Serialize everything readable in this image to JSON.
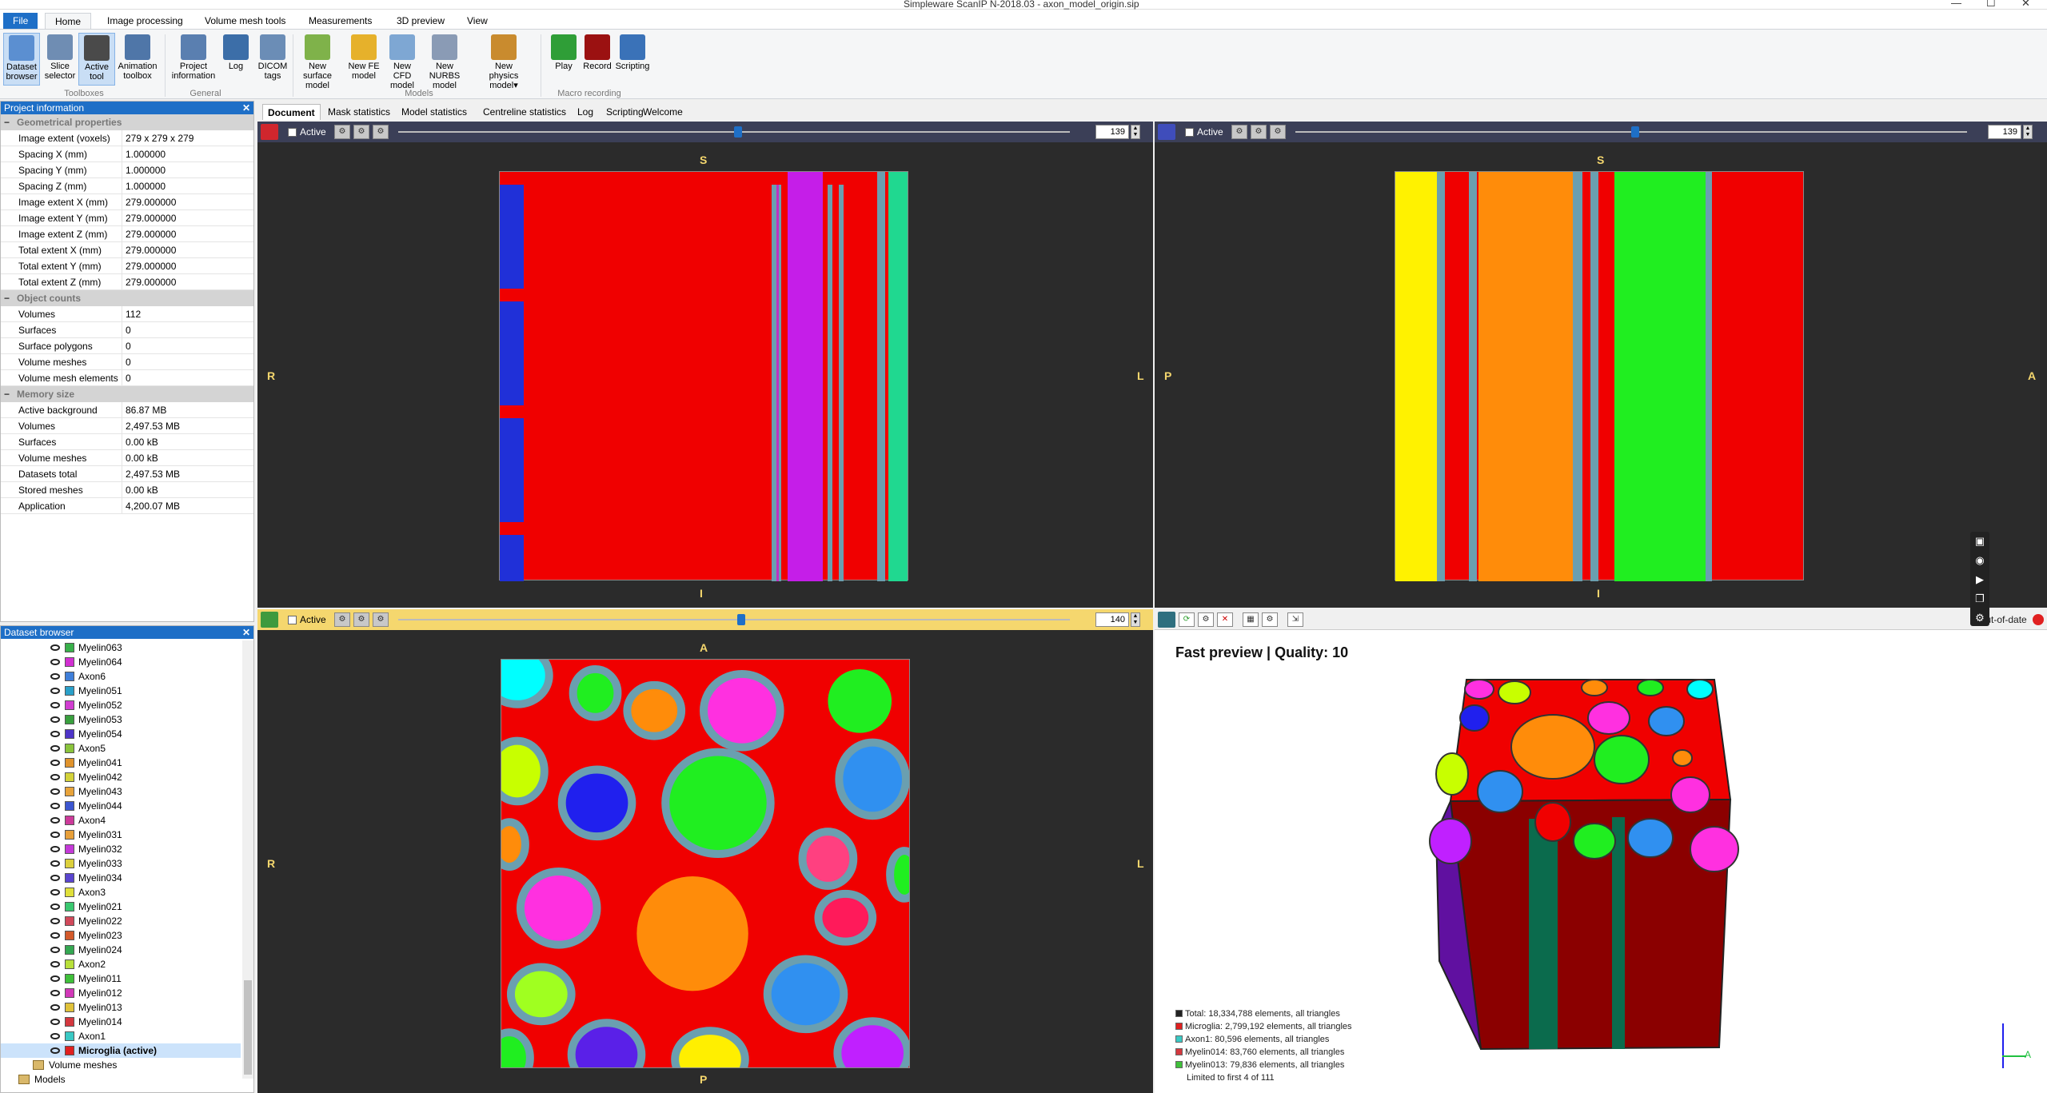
{
  "window": {
    "title": "Simpleware ScanIP N-2018.03 - axon_model_origin.sip",
    "minimize": "—",
    "maximize": "☐",
    "close": "✕"
  },
  "menu": {
    "file": "File",
    "tabs": [
      "Home",
      "Image processing",
      "Volume mesh tools",
      "Measurements",
      "3D preview",
      "View"
    ]
  },
  "ribbon": {
    "buttons": [
      {
        "label": "Dataset\nbrowser",
        "icon": "dataset-browser-icon",
        "color": "#5b8fd1"
      },
      {
        "label": "Slice\nselector",
        "icon": "slice-selector-icon",
        "color": "#6f8db3"
      },
      {
        "label": "Active\ntool",
        "icon": "active-tool-icon",
        "color": "#4a4a4a"
      },
      {
        "label": "Animation\ntoolbox",
        "icon": "animation-toolbox-icon",
        "color": "#4f76a8"
      },
      {
        "label": "Project\ninformation",
        "icon": "project-information-icon",
        "color": "#5a7fb0"
      },
      {
        "label": "Log",
        "icon": "log-icon",
        "color": "#3c6ea8"
      },
      {
        "label": "DICOM\ntags",
        "icon": "dicom-tags-icon",
        "color": "#6b8db6"
      },
      {
        "label": "New surface\nmodel",
        "icon": "new-surface-model-icon",
        "color": "#7fb24a"
      },
      {
        "label": "New FE\nmodel",
        "icon": "new-fe-model-icon",
        "color": "#e6b12b"
      },
      {
        "label": "New CFD\nmodel",
        "icon": "new-cfd-model-icon",
        "color": "#7ea7d3"
      },
      {
        "label": "New NURBS\nmodel",
        "icon": "new-nurbs-model-icon",
        "color": "#8a9bb5"
      },
      {
        "label": "New physics\nmodel▾",
        "icon": "new-physics-model-icon",
        "color": "#c98b2e"
      },
      {
        "label": "Play",
        "icon": "play-icon",
        "color": "#2f9e37"
      },
      {
        "label": "Record",
        "icon": "record-icon",
        "color": "#9b1111"
      },
      {
        "label": "Scripting",
        "icon": "scripting-icon",
        "color": "#3a72b8"
      }
    ],
    "groups": [
      "Toolboxes",
      "General",
      "Models",
      "Macro recording"
    ]
  },
  "project_info": {
    "header": "Project information",
    "sections": [
      {
        "title": "Geometrical properties",
        "rows": [
          [
            "Image extent (voxels)",
            "279 x 279 x 279"
          ],
          [
            "Spacing X (mm)",
            "1.000000"
          ],
          [
            "Spacing Y (mm)",
            "1.000000"
          ],
          [
            "Spacing Z (mm)",
            "1.000000"
          ],
          [
            "Image extent X (mm)",
            "279.000000"
          ],
          [
            "Image extent Y (mm)",
            "279.000000"
          ],
          [
            "Image extent Z (mm)",
            "279.000000"
          ],
          [
            "Total extent X (mm)",
            "279.000000"
          ],
          [
            "Total extent Y (mm)",
            "279.000000"
          ],
          [
            "Total extent Z (mm)",
            "279.000000"
          ]
        ]
      },
      {
        "title": "Object counts",
        "rows": [
          [
            "Volumes",
            "112"
          ],
          [
            "Surfaces",
            "0"
          ],
          [
            "Surface polygons",
            "0"
          ],
          [
            "Volume meshes",
            "0"
          ],
          [
            "Volume mesh elements",
            "0"
          ]
        ]
      },
      {
        "title": "Memory size",
        "rows": [
          [
            "Active background",
            "86.87 MB"
          ],
          [
            "Volumes",
            "2,497.53 MB"
          ],
          [
            "Surfaces",
            "0.00 kB"
          ],
          [
            "Volume meshes",
            "0.00 kB"
          ],
          [
            "Datasets total",
            "2,497.53 MB"
          ],
          [
            "Stored meshes",
            "0.00 kB"
          ],
          [
            "Application",
            "4,200.07 MB"
          ]
        ]
      }
    ]
  },
  "dataset_browser": {
    "header": "Dataset browser",
    "items": [
      {
        "name": "Myelin063",
        "color": "#38b04a"
      },
      {
        "name": "Myelin064",
        "color": "#d12fd1"
      },
      {
        "name": "Axon6",
        "color": "#3f7fd9"
      },
      {
        "name": "Myelin051",
        "color": "#2aa0c9"
      },
      {
        "name": "Myelin052",
        "color": "#d13ed1"
      },
      {
        "name": "Myelin053",
        "color": "#39a03e"
      },
      {
        "name": "Myelin054",
        "color": "#4e35c8"
      },
      {
        "name": "Axon5",
        "color": "#8ac43c"
      },
      {
        "name": "Myelin041",
        "color": "#e0932c"
      },
      {
        "name": "Myelin042",
        "color": "#d3d23a"
      },
      {
        "name": "Myelin043",
        "color": "#e8a33a"
      },
      {
        "name": "Myelin044",
        "color": "#3c56d0"
      },
      {
        "name": "Axon4",
        "color": "#cc3a9a"
      },
      {
        "name": "Myelin031",
        "color": "#e8a03a"
      },
      {
        "name": "Myelin032",
        "color": "#c43ad8"
      },
      {
        "name": "Myelin033",
        "color": "#dcd03c"
      },
      {
        "name": "Myelin034",
        "color": "#5a45cf"
      },
      {
        "name": "Axon3",
        "color": "#e0e03a"
      },
      {
        "name": "Myelin021",
        "color": "#3ac870"
      },
      {
        "name": "Myelin022",
        "color": "#d1495a"
      },
      {
        "name": "Myelin023",
        "color": "#d35a2b"
      },
      {
        "name": "Myelin024",
        "color": "#34a852"
      },
      {
        "name": "Axon2",
        "color": "#b8e03a"
      },
      {
        "name": "Myelin011",
        "color": "#3fc03a"
      },
      {
        "name": "Myelin012",
        "color": "#d138b8"
      },
      {
        "name": "Myelin013",
        "color": "#e0c23a"
      },
      {
        "name": "Myelin014",
        "color": "#d4383e"
      },
      {
        "name": "Axon1",
        "color": "#3ac9c4"
      },
      {
        "name": "Microglia (active)",
        "color": "#e02020",
        "active": true
      }
    ],
    "volume_meshes": "Volume meshes",
    "models": "Models"
  },
  "doc_tabs": [
    "Document",
    "Mask statistics",
    "Model statistics",
    "Centreline statistics",
    "Log",
    "Scripting",
    "Welcome"
  ],
  "views": {
    "tl": {
      "active": "Active",
      "slice": "139",
      "top": "S",
      "bottom": "I",
      "left": "R",
      "right": "L"
    },
    "tr": {
      "active": "Active",
      "slice": "139",
      "top": "S",
      "bottom": "I",
      "left": "P",
      "right": "A"
    },
    "bl": {
      "active": "Active",
      "slice": "140",
      "top": "A",
      "bottom": "P",
      "left": "R",
      "right": "L"
    }
  },
  "preview": {
    "title": "Fast preview | Quality: 10",
    "status": "Out-of-date",
    "legend": [
      {
        "text": "Total: 18,334,788 elements, all triangles",
        "color": "#222222"
      },
      {
        "text": "Microglia: 2,799,192 elements, all triangles",
        "color": "#e02020"
      },
      {
        "text": "Axon1: 80,596 elements, all triangles",
        "color": "#3ac9c4"
      },
      {
        "text": "Myelin014: 83,760 elements, all triangles",
        "color": "#d4383e"
      },
      {
        "text": "Myelin013: 79,836 elements, all triangles",
        "color": "#3fc03a"
      }
    ],
    "limit": "Limited to first 4 of 111"
  }
}
